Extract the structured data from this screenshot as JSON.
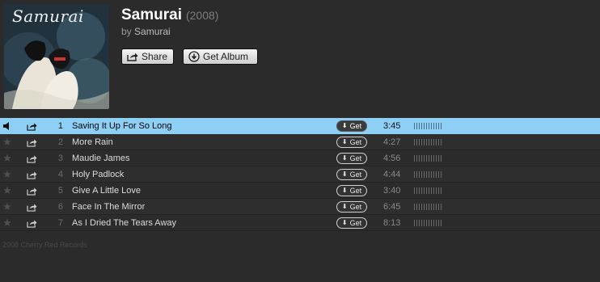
{
  "album": {
    "cover_text": "Samurai",
    "title": "Samurai",
    "year": "(2008)",
    "by_prefix": "by",
    "artist": "Samurai"
  },
  "buttons": {
    "share_label": "Share",
    "get_album_label": "Get Album"
  },
  "tracks": [
    {
      "number": "1",
      "name": "Saving It Up For So Long",
      "get_label": "Get",
      "time": "3:45",
      "selected": true
    },
    {
      "number": "2",
      "name": "More Rain",
      "get_label": "Get",
      "time": "4:27",
      "selected": false
    },
    {
      "number": "3",
      "name": "Maudie James",
      "get_label": "Get",
      "time": "4:56",
      "selected": false
    },
    {
      "number": "4",
      "name": "Holy Padlock",
      "get_label": "Get",
      "time": "4:44",
      "selected": false
    },
    {
      "number": "5",
      "name": "Give A Little Love",
      "get_label": "Get",
      "time": "3:40",
      "selected": false
    },
    {
      "number": "6",
      "name": "Face In The Mirror",
      "get_label": "Get",
      "time": "6:45",
      "selected": false
    },
    {
      "number": "7",
      "name": "As I Dried The Tears Away",
      "get_label": "Get",
      "time": "8:13",
      "selected": false
    }
  ],
  "footer": {
    "copyright": "2008 Cherry Red Records"
  },
  "colors": {
    "background": "#2b2b2b",
    "selected_row": "#8ecff5",
    "title_text": "#ffffff"
  },
  "icons": {
    "speaker": "speaker-icon",
    "star": "star-icon",
    "share": "share-icon",
    "download": "download-icon"
  }
}
